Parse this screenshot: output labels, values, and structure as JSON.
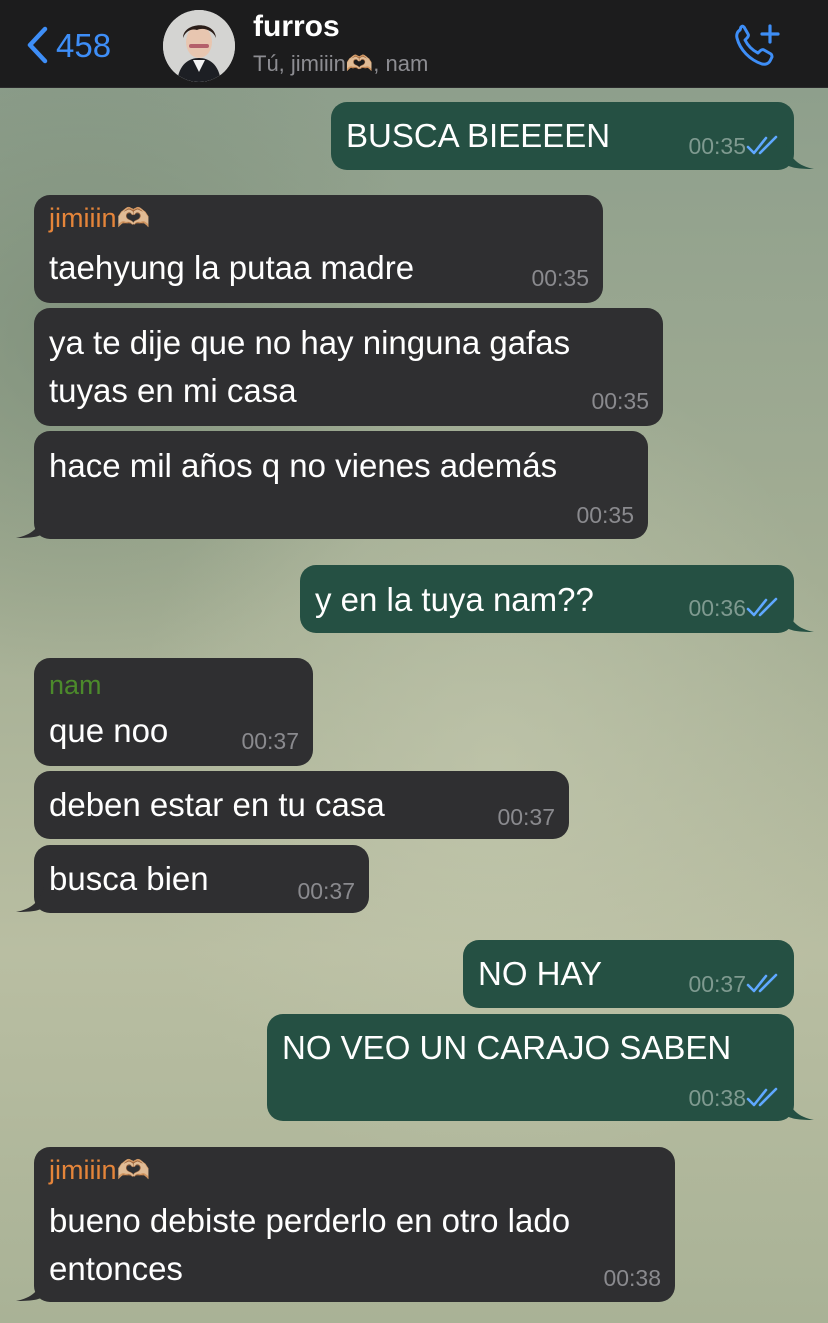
{
  "header": {
    "back_count": "458",
    "title": "furros",
    "subtitle": "Tú, jimiiin🫶🏼, nam",
    "accent": "#3e8ef7"
  },
  "messages": [
    {
      "side": "out",
      "text": "BUSCA BIEEEEN",
      "time": "00:35",
      "read": true
    },
    {
      "side": "in",
      "sender": "jimiiin🫶🏼",
      "text": "taehyung la putaa madre",
      "time": "00:35"
    },
    {
      "side": "in",
      "lines": [
        "ya te dije que no hay ninguna gafas",
        "tuyas en mi casa"
      ],
      "time": "00:35"
    },
    {
      "side": "in",
      "text": "hace mil años q no vienes además",
      "time": "00:35"
    },
    {
      "side": "out",
      "text": "y en la tuya nam??",
      "time": "00:36",
      "read": true
    },
    {
      "side": "in",
      "sender": "nam",
      "text": "que noo",
      "time": "00:37"
    },
    {
      "side": "in",
      "text": "deben estar en tu casa",
      "time": "00:37"
    },
    {
      "side": "in",
      "text": "busca bien",
      "time": "00:37"
    },
    {
      "side": "out",
      "text": "NO HAY",
      "time": "00:37",
      "read": true
    },
    {
      "side": "out",
      "text": "NO VEO UN CARAJO SABEN",
      "time": "00:38",
      "read": true
    },
    {
      "side": "in",
      "sender": "jimiiin🫶🏼",
      "lines": [
        "bueno debiste perderlo en otro lado",
        "entonces"
      ],
      "time": "00:38"
    }
  ],
  "colors": {
    "incoming_bubble": "#2f2f31",
    "outgoing_bubble": "#255043",
    "sender_jimiiin": "#e5853a",
    "sender_nam": "#4c8a2b",
    "read_ticks": "#5fa8ff"
  }
}
